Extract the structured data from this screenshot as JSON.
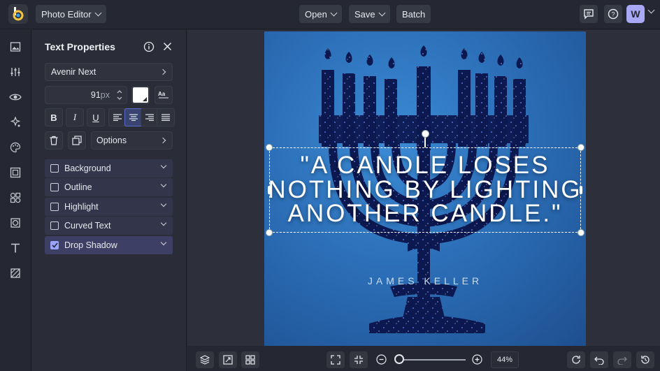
{
  "topbar": {
    "app_menu": "Photo Editor",
    "open": "Open",
    "save": "Save",
    "batch": "Batch",
    "avatar_letter": "W"
  },
  "panel": {
    "title": "Text Properties",
    "font": "Avenir Next",
    "font_size": "91",
    "font_size_unit": "px",
    "options": "Options",
    "sections": [
      {
        "label": "Background",
        "checked": false
      },
      {
        "label": "Outline",
        "checked": false
      },
      {
        "label": "Highlight",
        "checked": false
      },
      {
        "label": "Curved Text",
        "checked": false
      },
      {
        "label": "Drop Shadow",
        "checked": true
      }
    ]
  },
  "canvas": {
    "quote_lines": [
      "\"A CANDLE LOSES",
      "NOTHING BY LIGHTING",
      "ANOTHER CANDLE.\""
    ],
    "author": "JAMES KELLER"
  },
  "bottombar": {
    "zoom": "44%"
  },
  "colors": {
    "accent": "#9aa3ff",
    "background": "#252832",
    "artboard": "#2c6fb8",
    "menorah": "#0d1a4a"
  }
}
